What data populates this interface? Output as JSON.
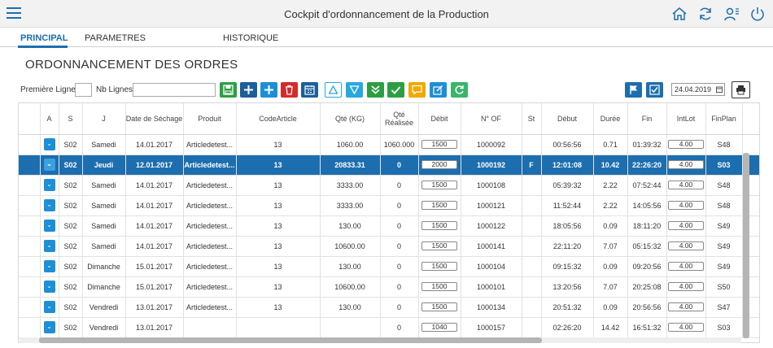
{
  "shell": {
    "title": "Cockpit d'ordonnancement de la Production"
  },
  "tabs": [
    {
      "label": "PRINCIPAL"
    },
    {
      "label": "PARAMETRES"
    },
    {
      "label": "HISTORIQUE"
    }
  ],
  "page": {
    "title": "ORDONNANCEMENT DES ORDRES"
  },
  "toolbar": {
    "premiere_ligne_label": "Première Ligne",
    "nb_lignes_label": "Nb Lignes",
    "premiere_ligne_value": "",
    "nb_lignes_value": "",
    "date_value": "24.04.2019"
  },
  "toolbar_buttons": [
    {
      "icon": "save-icon",
      "color": "#2e9e44"
    },
    {
      "icon": "add-icon",
      "color": "#1d5f99"
    },
    {
      "icon": "insert-icon",
      "color": "#1d8fd6"
    },
    {
      "icon": "delete-icon",
      "color": "#d42b2b"
    },
    {
      "icon": "calendar-icon",
      "color": "#1d5f99"
    },
    {
      "icon": "move-up-icon",
      "color": "#29a8e0"
    },
    {
      "icon": "move-down-icon",
      "color": "#29a8e0"
    },
    {
      "icon": "double-down-icon",
      "color": "#2e9e44"
    },
    {
      "icon": "check-icon",
      "color": "#2e9e44"
    },
    {
      "icon": "comment-icon",
      "color": "#f0a800"
    },
    {
      "icon": "edit-icon",
      "color": "#1d8fd6"
    },
    {
      "icon": "refresh-icon",
      "color": "#3bb56b"
    },
    {
      "icon": "flag-icon",
      "color": "#1d6eae"
    },
    {
      "icon": "approve-icon",
      "color": "#1d6eae"
    },
    {
      "icon": "print-icon",
      "color": "#333333"
    }
  ],
  "table": {
    "columns": [
      "A",
      "S",
      "J",
      "Date de Séchage",
      "Produit",
      "CodeArticle",
      "Qté (KG)",
      "Qté Réalisée",
      "Débit",
      "N° OF",
      "St",
      "Début",
      "Durée",
      "Fin",
      "IntLot",
      "FinPlan"
    ],
    "rows": [
      [
        "S02",
        "Samedi",
        "14.01.2017",
        "Articledetest...",
        "13",
        "1060.00",
        "1060.000",
        "1500",
        "1000092",
        "",
        "00:56:56",
        "0.71",
        "01:39:32",
        "4.00",
        "S48"
      ],
      [
        "S02",
        "Jeudi",
        "12.01.2017",
        "Articledetest...",
        "13",
        "20833.31",
        "0",
        "2000",
        "1000192",
        "F",
        "12:01:08",
        "10.42",
        "22:26:20",
        "4.00",
        "S03"
      ],
      [
        "S02",
        "Samedi",
        "14.01.2017",
        "Articledetest...",
        "13",
        "3333.00",
        "0",
        "1500",
        "1000108",
        "",
        "05:39:32",
        "2.22",
        "07:52:44",
        "4.00",
        "S48"
      ],
      [
        "S02",
        "Samedi",
        "14.01.2017",
        "Articledetest...",
        "13",
        "3333.00",
        "0",
        "1500",
        "1000121",
        "",
        "11:52:44",
        "2.22",
        "14:05:56",
        "4.00",
        "S48"
      ],
      [
        "S02",
        "Samedi",
        "14.01.2017",
        "Articledetest...",
        "13",
        "130.00",
        "0",
        "1500",
        "1000122",
        "",
        "18:05:56",
        "0.09",
        "18:11:20",
        "4.00",
        "S49"
      ],
      [
        "S02",
        "Samedi",
        "14.01.2017",
        "Articledetest...",
        "13",
        "10600.00",
        "0",
        "1500",
        "1000141",
        "",
        "22:11:20",
        "7.07",
        "05:15:32",
        "4.00",
        "S49"
      ],
      [
        "S02",
        "Dimanche",
        "15.01.2017",
        "Articledetest...",
        "13",
        "130.00",
        "0",
        "1500",
        "1000104",
        "",
        "09:15:32",
        "0.09",
        "09:20:56",
        "4.00",
        "S49"
      ],
      [
        "S02",
        "Dimanche",
        "15.01.2017",
        "Articledetest...",
        "13",
        "10600.00",
        "0",
        "1500",
        "1000101",
        "",
        "13:20:56",
        "7.07",
        "20:25:08",
        "4.00",
        "S50"
      ],
      [
        "S02",
        "Vendredi",
        "13.01.2017",
        "Articledetest...",
        "13",
        "130.00",
        "0",
        "1500",
        "1000134",
        "",
        "20:51:32",
        "0.09",
        "20:56:56",
        "4.00",
        "S47"
      ],
      [
        "S02",
        "Vendredi",
        "13.01.2017",
        "",
        "",
        "",
        "0",
        "1040",
        "1000157",
        "",
        "02:26:20",
        "14.42",
        "16:51:32",
        "4.00",
        "S03"
      ]
    ],
    "selected_row": 1
  },
  "colors": {
    "accent": "#1d6eae",
    "selected_row": "#1d6eae"
  }
}
